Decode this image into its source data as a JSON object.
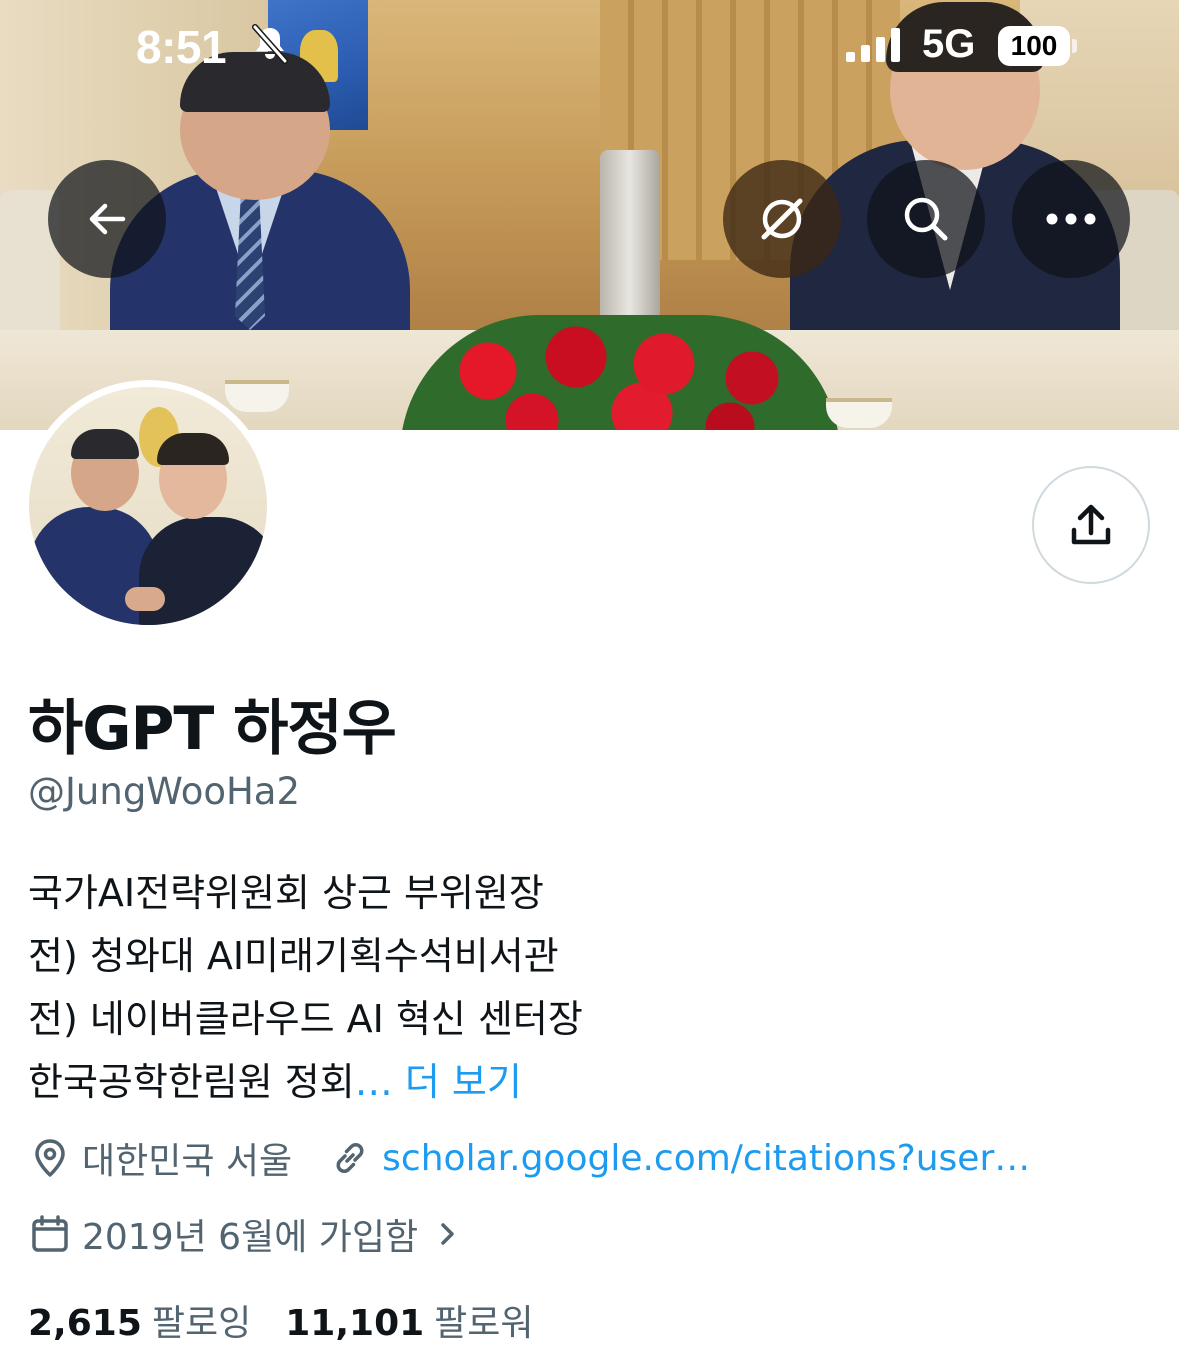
{
  "status_bar": {
    "time": "8:51",
    "network": "5G",
    "battery": "100"
  },
  "header_buttons": {
    "back": "back-arrow-icon",
    "grok": "grok-icon",
    "search": "search-icon",
    "more": "more-icon"
  },
  "profile": {
    "display_name": "하GPT 하정우",
    "handle": "@JungWooHa2",
    "bio_lines": [
      "국가AI전략위원회 상근 부위원장",
      "전) 청와대 AI미래기획수석비서관",
      "전) 네이버클라우드 AI 혁신 센터장",
      "한국공학한림원 정회"
    ],
    "bio_ellipsis": "…",
    "bio_more": "더 보기",
    "location": "대한민국 서울",
    "website": "scholar.google.com/citations?user…",
    "joined": "2019년 6월에 가입함",
    "following_count": "2,615",
    "following_label": "팔로잉",
    "followers_count": "11,101",
    "followers_label": "팔로워"
  },
  "colors": {
    "text": "#0f1419",
    "secondary": "#536471",
    "link": "#1d9bf0",
    "border": "#cfd9de"
  }
}
